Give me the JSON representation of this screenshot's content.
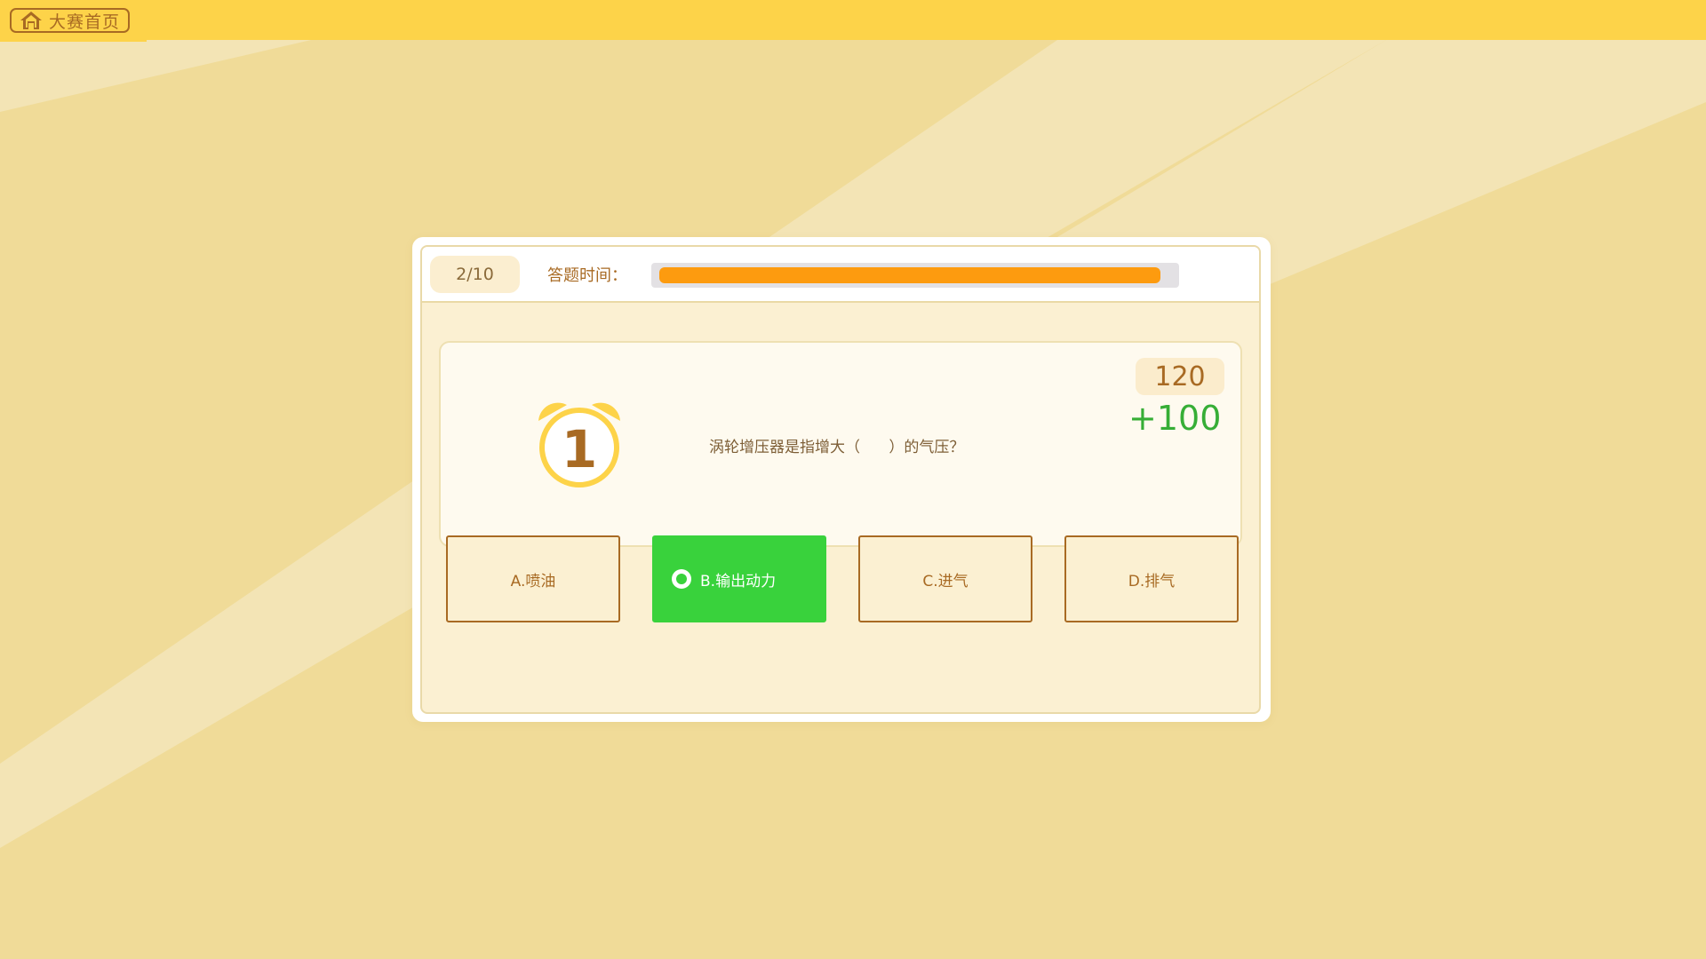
{
  "app": {
    "home_button_label": "大赛首页"
  },
  "quiz": {
    "progress": "2/10",
    "timer_label": "答题时间：",
    "timer_remaining_fraction": 0.98,
    "question_number": "1",
    "question_text": "涡轮增压器是指增大（      ）的气压？",
    "score": "120",
    "score_delta": "+100",
    "options": [
      {
        "label": "A.喷油",
        "selected": false
      },
      {
        "label": "B.输出动力",
        "selected": true
      },
      {
        "label": "C.进气",
        "selected": false
      },
      {
        "label": "D.排气",
        "selected": false
      }
    ]
  },
  "colors": {
    "topbar": "#fdd349",
    "brand_brown": "#a86a23",
    "timer_fill": "#fd9b0f",
    "selected_option": "#39d23c",
    "score_delta": "#36ae36"
  },
  "icons": {
    "home": "home-icon",
    "clock": "alarm-clock-icon"
  }
}
